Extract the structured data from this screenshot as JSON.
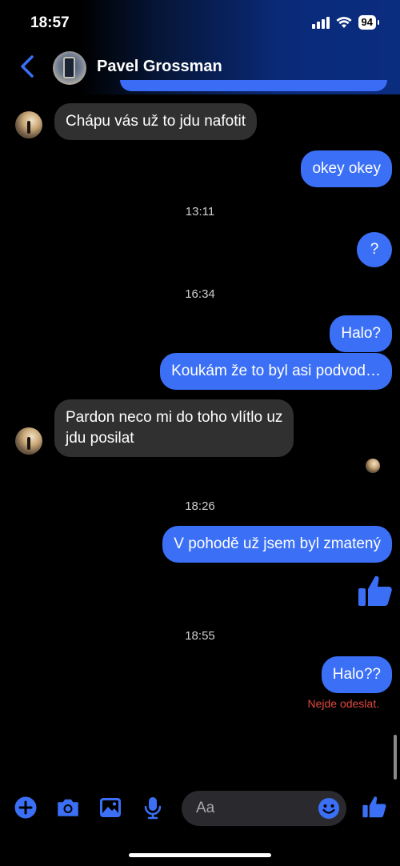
{
  "status_bar": {
    "time": "18:57",
    "battery": "94"
  },
  "header": {
    "contact_name": "Pavel Grossman"
  },
  "messages": [
    {
      "type": "in",
      "text": "Chápu vás už to jdu nafotit"
    },
    {
      "type": "out",
      "text": "okey okey"
    },
    {
      "type": "time",
      "text": "13:11"
    },
    {
      "type": "out",
      "text": "?"
    },
    {
      "type": "time",
      "text": "16:34"
    },
    {
      "type": "out",
      "text": "Halo?"
    },
    {
      "type": "out",
      "text": "Koukám že to byl asi podvod…"
    },
    {
      "type": "in",
      "line1": "Pardon neco mi do toho vlítlo uz",
      "line2": "jdu posilat"
    },
    {
      "type": "time",
      "text": "18:26"
    },
    {
      "type": "out",
      "text": "V pohodě už jsem byl zmatený"
    },
    {
      "type": "like"
    },
    {
      "type": "time",
      "text": "18:55"
    },
    {
      "type": "out",
      "text": "Halo??",
      "error": "Nejde odeslat."
    }
  ],
  "composer": {
    "placeholder": "Aa",
    "icons": [
      "plus-icon",
      "camera-icon",
      "gallery-icon",
      "microphone-icon",
      "emoji-icon",
      "thumbs-up-icon"
    ]
  },
  "colors": {
    "accent": "#3b70f6",
    "incoming": "#303030",
    "error": "#e0483e"
  }
}
